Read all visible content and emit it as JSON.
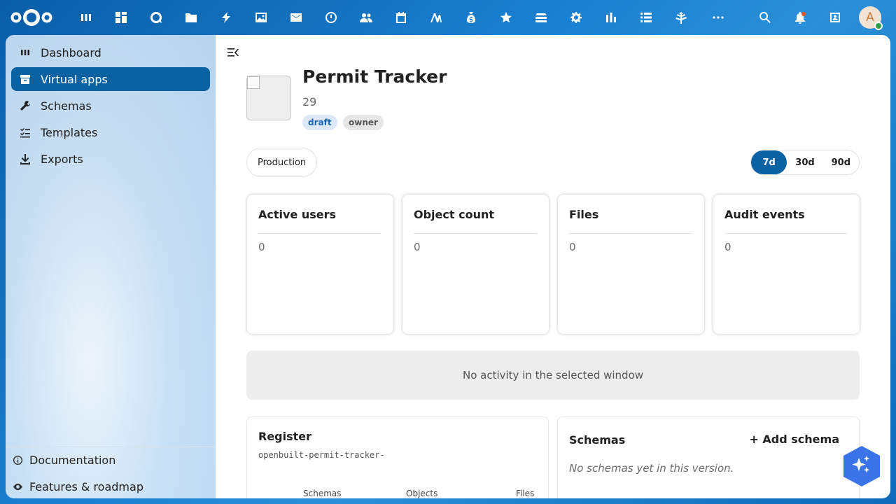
{
  "topbar": {
    "apps": [
      {
        "icon": "dashboard-icon"
      },
      {
        "icon": "grid-icon"
      },
      {
        "icon": "talk-icon"
      },
      {
        "icon": "files-icon"
      },
      {
        "icon": "activity-icon"
      },
      {
        "icon": "photos-icon"
      },
      {
        "icon": "mail-icon"
      },
      {
        "icon": "clock-icon"
      },
      {
        "icon": "contacts-icon"
      },
      {
        "icon": "calendar-icon"
      },
      {
        "icon": "signature-icon"
      },
      {
        "icon": "money-bag-icon"
      },
      {
        "icon": "star-icon"
      },
      {
        "icon": "layers-icon"
      },
      {
        "icon": "settings-gear-icon"
      },
      {
        "icon": "bar-chart-icon"
      },
      {
        "icon": "list-icon"
      },
      {
        "icon": "tree-icon"
      },
      {
        "icon": "more-icon"
      }
    ],
    "avatar_letter": "A"
  },
  "sidebar": {
    "items": [
      {
        "label": "Dashboard",
        "icon": "dashboard-icon",
        "active": false
      },
      {
        "label": "Virtual apps",
        "icon": "archive-icon",
        "active": true
      },
      {
        "label": "Schemas",
        "icon": "wrench-icon",
        "active": false
      },
      {
        "label": "Templates",
        "icon": "checklist-icon",
        "active": false
      },
      {
        "label": "Exports",
        "icon": "download-icon",
        "active": false
      }
    ],
    "footer": [
      {
        "label": "Documentation",
        "icon": "info-icon"
      },
      {
        "label": "Features & roadmap",
        "icon": "eye-icon"
      }
    ]
  },
  "app": {
    "title": "Permit Tracker",
    "subtitle": "29",
    "tags": [
      "draft",
      "owner"
    ]
  },
  "controls": {
    "environment": "Production",
    "ranges": [
      "7d",
      "30d",
      "90d"
    ],
    "active_range": "7d"
  },
  "metrics": [
    {
      "label": "Active users",
      "value": "0"
    },
    {
      "label": "Object count",
      "value": "0"
    },
    {
      "label": "Files",
      "value": "0"
    },
    {
      "label": "Audit events",
      "value": "0"
    }
  ],
  "activity_empty": "No activity in the selected window",
  "register": {
    "title": "Register",
    "slug": "openbuilt-permit-tracker-",
    "columns": [
      "Schemas",
      "Objects",
      "Files"
    ]
  },
  "schemas": {
    "title": "Schemas",
    "add_label": "+ Add schema",
    "empty": "No schemas yet in this version."
  },
  "colors": {
    "accent": "#0a62a3",
    "draft_tag_bg": "#dce8f7",
    "fab": "#3b73e8"
  }
}
